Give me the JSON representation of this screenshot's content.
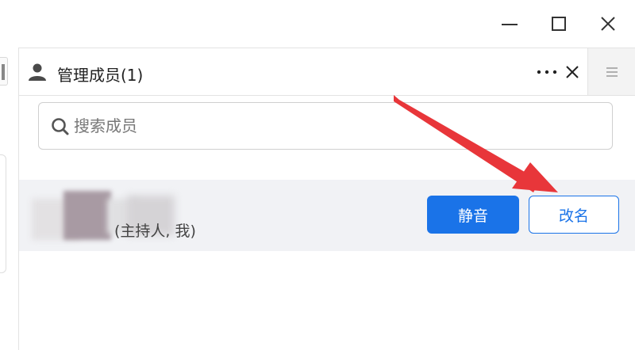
{
  "window_controls": {
    "minimize": "minimize",
    "maximize": "maximize",
    "close": "close"
  },
  "panel": {
    "title": "管理成员(1)",
    "more_label": "···",
    "close_label": "✕"
  },
  "search": {
    "placeholder": "搜索成员",
    "value": ""
  },
  "members": [
    {
      "role": "(主持人, 我)",
      "mute_label": "静音",
      "rename_label": "改名"
    }
  ],
  "colors": {
    "accent": "#1a73e8",
    "annotation_arrow": "#e8363a",
    "row_bg": "#f1f2f5"
  },
  "icons": {
    "header": "person-icon",
    "search": "search-icon",
    "menu": "hamburger-icon",
    "annotation": "red-arrow-annotation"
  }
}
